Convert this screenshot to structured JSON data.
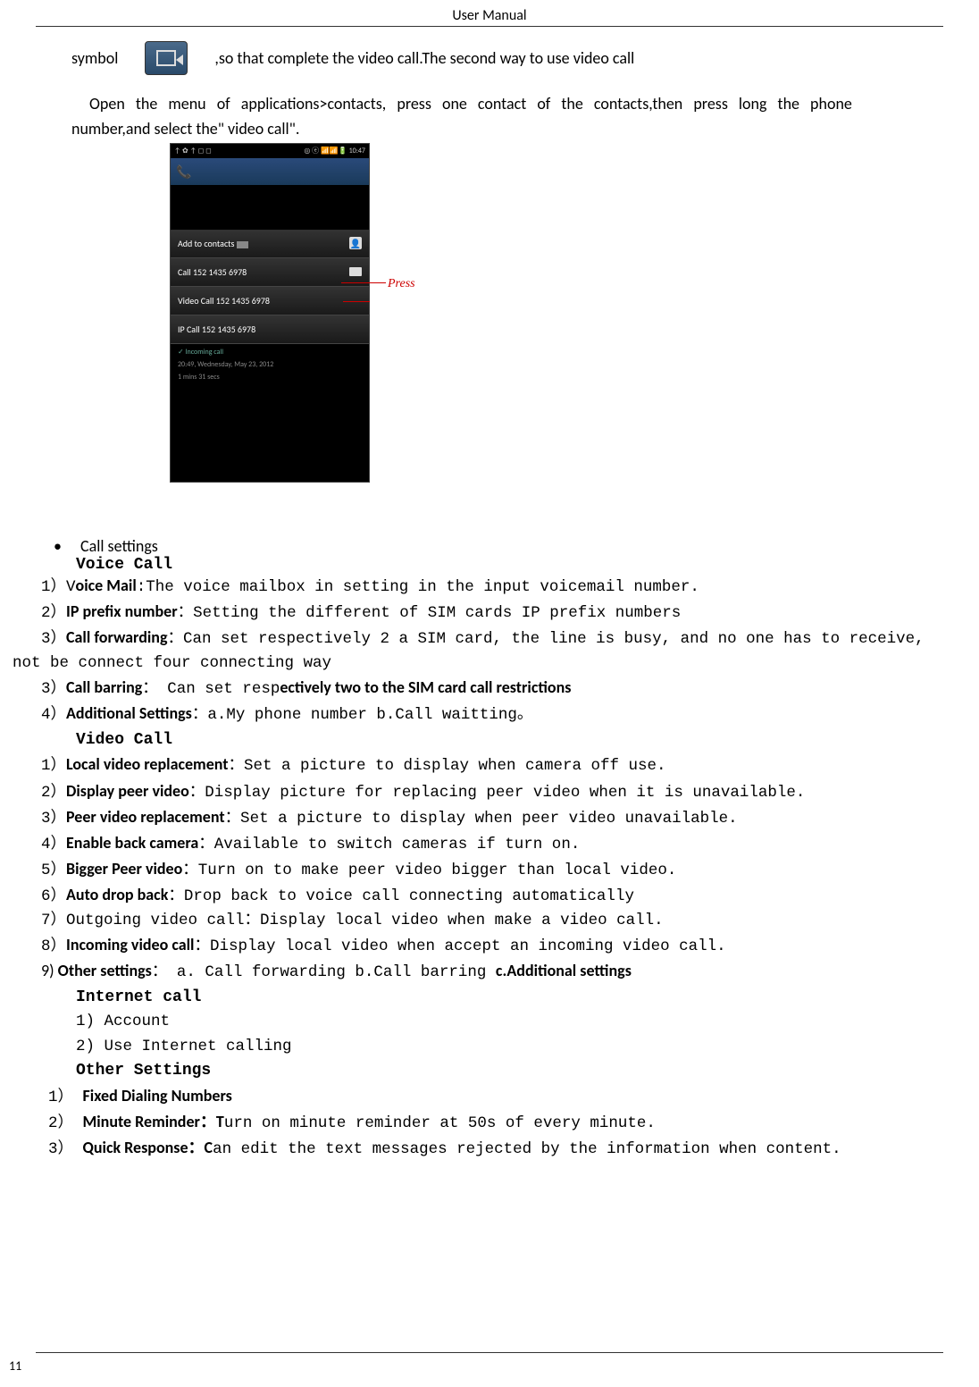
{
  "header": "User    Manual",
  "line1_a": "symbol",
  "line1_b": ",so that complete the video call.The second way to use video call",
  "para2": "Open  the  menu  of  applications>contacts,  press    one  contact  of  the  contacts,then  press  long  the  phone",
  "para2b": "number,and select the\" video call\".",
  "screenshot": {
    "status_left": "↑ ✿ ↑ ◻ ◻",
    "status_right": "◎ ⓔ 📶📶🔋 10:47",
    "item1": "Add to contacts",
    "item2": "Call 152 1435 6978",
    "item3": "Video Call 152 1435 6978",
    "item4": "IP Call 152 1435 6978",
    "recent_label": "✓ Incoming call",
    "recent_time": "20:49, Wednesday, May 23, 2012",
    "recent_dur": "1 mins 31 secs",
    "press": "Press"
  },
  "sections": {
    "call_settings": "Call settings",
    "voice_call": "Voice Call",
    "voice": [
      {
        "n": "1）V",
        "bold": "oice Mail",
        "rest": ":The voice mailbox in setting in the input voicemail number."
      },
      {
        "n": "2）",
        "bold": "IP prefix number",
        "rest": "：Setting the different of SIM cards IP prefix numbers"
      },
      {
        "n": "3）",
        "bold": "Call forwarding",
        "rest": "：Can set respectively 2 a SIM card, the line is busy, and no one has to receive,"
      },
      {
        "cont": "not be connect four connecting way"
      },
      {
        "n": "3）",
        "bold": "Call barring",
        "rest": "： Can set resp",
        "bold2": "ectively two to the SIM card call restrictions"
      },
      {
        "n": "4）",
        "bold": "Additional Settings",
        "rest": "：a.My phone number b.Call waitting。"
      }
    ],
    "video_call": "Video Call",
    "video": [
      {
        "n": "1）",
        "bold": "Local video replacement",
        "rest": "：Set a picture to display when camera off use."
      },
      {
        "n": "2）",
        "bold": "Display peer video",
        "rest": "：Display picture for replacing peer video when it is unavailable."
      },
      {
        "n": "3）",
        "bold": "Peer video replacement",
        "rest": "：Set a picture to display when peer video unavailable."
      },
      {
        "n": "4）",
        "bold": "Enable back camera",
        "rest": "：Available to switch cameras if turn on."
      },
      {
        "n": "5）",
        "bold": "Bigger Peer video",
        "rest": "：Turn on to make peer video bigger than local video."
      },
      {
        "n": "6）",
        "bold": "Auto drop back",
        "rest": "：Drop back to voice call connecting automatically"
      },
      {
        "n": "7）",
        "rest": "Outgoing video call：Display local video when make a video call."
      },
      {
        "n": "8）",
        "bold": "Incoming video call",
        "rest": "：Display local video when accept an incoming video call."
      },
      {
        "n": "9) ",
        "bold": "Other settings",
        "rest": "：  a. Call forwarding  b.Call barring  ",
        "bold2": "c.Additional settings"
      }
    ],
    "internet_call": "Internet call",
    "internet": [
      "1)  Account",
      "2)  Use Internet calling"
    ],
    "other_settings": "Other Settings",
    "other": [
      {
        "n": "1） ",
        "bold": "Fixed Dialing Numbers"
      },
      {
        "n": "2） ",
        "bold": "Minute Reminder：T",
        "rest": "urn on minute reminder at 50s of every minute."
      },
      {
        "n": "3） ",
        "bold": "Quick Response：C",
        "rest": "an edit the text messages rejected by the information when content."
      }
    ]
  },
  "page_num": "11"
}
